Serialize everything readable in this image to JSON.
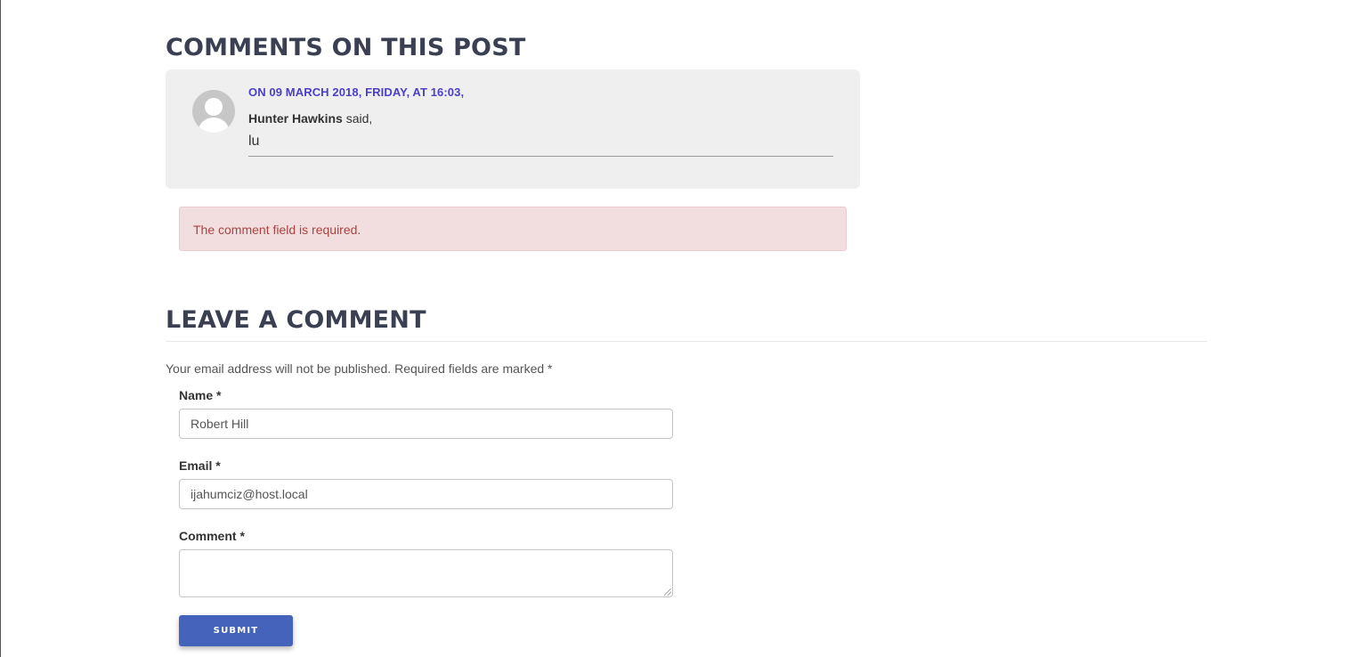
{
  "comments_section": {
    "title": "COMMENTS ON THIS POST",
    "comments": [
      {
        "meta": "ON 09 MARCH 2018, FRIDAY, AT 16:03,",
        "author": "Hunter Hawkins",
        "said": " said,",
        "text": "lu"
      }
    ]
  },
  "alert": {
    "message": "The comment field is required."
  },
  "leave_comment": {
    "title": "LEAVE A COMMENT",
    "notice": "Your email address will not be published. Required fields are marked *",
    "name_label": "Name *",
    "name_value": "Robert Hill",
    "email_label": "Email *",
    "email_value": "ijahumciz@host.local",
    "comment_label": "Comment *",
    "comment_value": "",
    "submit_label": "SUBMIT"
  },
  "colors": {
    "heading": "#3a3f52",
    "comment_meta": "#4b3fc7",
    "alert_bg": "#f2dede",
    "alert_text": "#a94442",
    "submit_bg": "#4563bb"
  },
  "icons": {
    "avatar": "default-user-avatar-icon",
    "textarea_grip": "resize-grip-icon"
  }
}
